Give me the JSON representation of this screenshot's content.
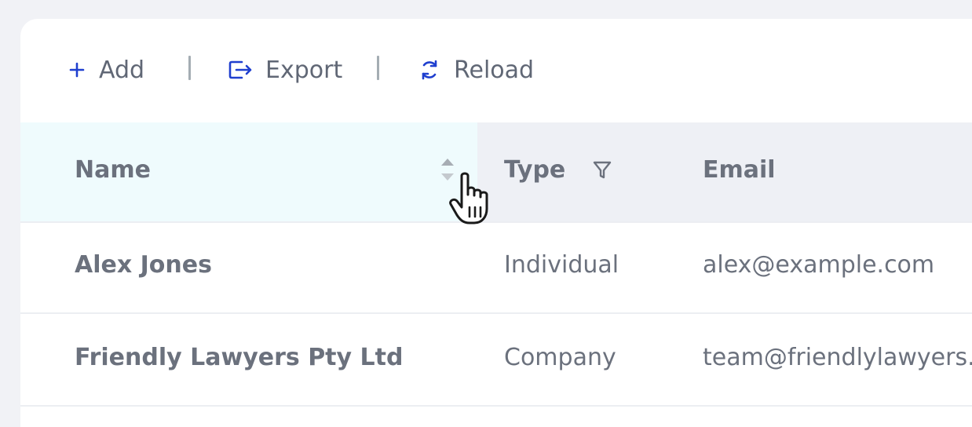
{
  "toolbar": {
    "add_label": "Add",
    "export_label": "Export",
    "reload_label": "Reload"
  },
  "colors": {
    "accent": "#1f3fcf",
    "text": "#6b717d",
    "header_bg": "#eef0f5",
    "sorted_column_bg": "#effbfd"
  },
  "icons": {
    "add": "plus-icon",
    "export": "export-icon",
    "reload": "reload-icon",
    "sort": "sort-icon",
    "filter": "filter-icon",
    "cursor": "hand-pointer-icon"
  },
  "table": {
    "columns": [
      {
        "label": "Name"
      },
      {
        "label": "Type"
      },
      {
        "label": "Email"
      }
    ],
    "rows": [
      {
        "name": "Alex Jones",
        "type": "Individual",
        "email": "alex@example.com"
      },
      {
        "name": "Friendly Lawyers Pty Ltd",
        "type": "Company",
        "email": "team@friendlylawyers.com"
      }
    ]
  }
}
